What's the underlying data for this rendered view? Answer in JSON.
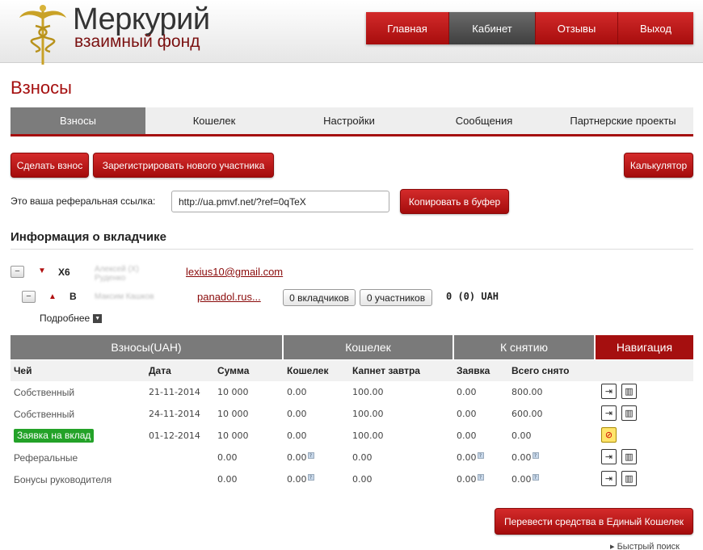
{
  "header": {
    "logo_title": "Меркурий",
    "logo_subtitle": "взаимный фонд",
    "nav": [
      {
        "label": "Главная",
        "active": false
      },
      {
        "label": "Кабинет",
        "active": true
      },
      {
        "label": "Отзывы",
        "active": false
      },
      {
        "label": "Выход",
        "active": false
      }
    ]
  },
  "page_title": "Взносы",
  "tabs": [
    {
      "label": "Взносы",
      "active": true
    },
    {
      "label": "Кошелек",
      "active": false
    },
    {
      "label": "Настройки",
      "active": false
    },
    {
      "label": "Сообщения",
      "active": false
    },
    {
      "label": "Партнерские проекты",
      "active": false
    }
  ],
  "actions": {
    "make_deposit": "Сделать взнос",
    "register_member": "Зарегистрировать нового участника",
    "calculator": "Калькулятор",
    "copy": "Копировать в буфер",
    "transfer": "Перевести средства в Единый Кошелек"
  },
  "referral": {
    "label": "Это ваша реферальная ссылка:",
    "value": "http://ua.pmvf.net/?ref=0qTeX"
  },
  "investor": {
    "title": "Информация о вкладчике",
    "rows": [
      {
        "level": "X6",
        "name": "Алексей (Х) Руденко",
        "email": "lexius10@gmail.com"
      },
      {
        "level": "B",
        "name": "Максим Кашков",
        "email": "panadol.rus..."
      }
    ],
    "investors_btn": "0 вкладчиков",
    "members_btn": "0 участников",
    "balance": "0 (0) UAH",
    "more": "Подробнее"
  },
  "table": {
    "groups": [
      "Взносы(UAH)",
      "Кошелек",
      "К снятию",
      "Навигация"
    ],
    "columns": [
      "Чей",
      "Дата",
      "Сумма",
      "Кошелек",
      "Капнет завтра",
      "Заявка",
      "Всего снято"
    ],
    "rows": [
      {
        "who": "Собственный",
        "date": "21-11-2014",
        "sum": "10 000",
        "wallet": "0.00",
        "tomorrow": "100.00",
        "request": "0.00",
        "total": "800.00"
      },
      {
        "who": "Собственный",
        "date": "24-11-2014",
        "sum": "10 000",
        "wallet": "0.00",
        "tomorrow": "100.00",
        "request": "0.00",
        "total": "600.00"
      },
      {
        "who": "Заявка на вклад",
        "date": "01-12-2014",
        "sum": "10 000",
        "wallet": "0.00",
        "tomorrow": "100.00",
        "request": "0.00",
        "total": "0.00"
      },
      {
        "who": "Реферальные",
        "date": "",
        "sum": "0.00",
        "wallet": "0.00",
        "tomorrow": "0.00",
        "request": "0.00",
        "total": "0.00"
      },
      {
        "who": "Бонусы руководителя",
        "date": "",
        "sum": "0.00",
        "wallet": "0.00",
        "tomorrow": "0.00",
        "request": "0.00",
        "total": "0.00"
      }
    ]
  },
  "footer": {
    "quick_search": "Быстрый поиск"
  },
  "colors": {
    "brand_red": "#a50f0f",
    "tab_active": "#7c7c7c",
    "status_green": "#23a228"
  }
}
